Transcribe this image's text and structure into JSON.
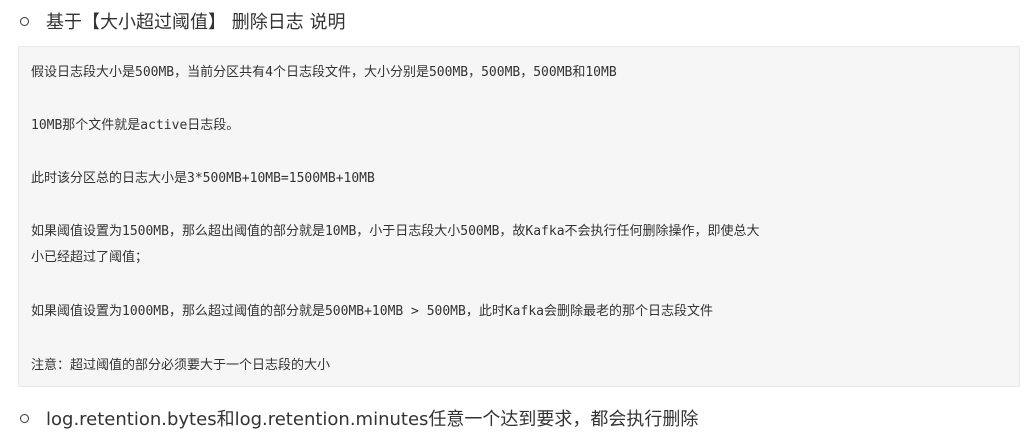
{
  "heading": {
    "text": "基于【大小超过阈值】 删除日志 说明"
  },
  "code_block": {
    "lines": [
      "假设日志段大小是500MB，当前分区共有4个日志段文件，大小分别是500MB，500MB，500MB和10MB",
      "10MB那个文件就是active日志段。",
      "此时该分区总的日志大小是3*500MB+10MB=1500MB+10MB",
      "如果阈值设置为1500MB，那么超出阈值的部分就是10MB，小于日志段大小500MB，故Kafka不会执行任何删除操作，即使总大",
      "小已经超过了阈值；",
      "如果阈值设置为1000MB，那么超过阈值的部分就是500MB+10MB > 500MB，此时Kafka会删除最老的那个日志段文件",
      "注意：超过阈值的部分必须要大于一个日志段的大小"
    ]
  },
  "footer_bullet": {
    "text": "log.retention.bytes和log.retention.minutes任意一个达到要求，都会执行删除"
  }
}
